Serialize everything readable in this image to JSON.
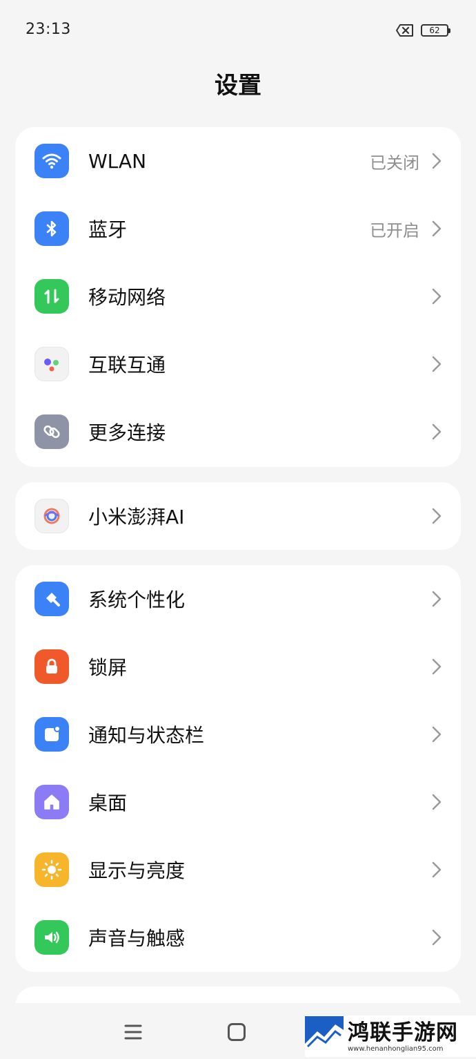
{
  "status_bar": {
    "time": "23:13",
    "battery": "62"
  },
  "title": "设置",
  "groups": [
    {
      "items": [
        {
          "label": "WLAN",
          "value": "已关闭",
          "icon": "wifi-icon",
          "color": "#3b82f6"
        },
        {
          "label": "蓝牙",
          "value": "已开启",
          "icon": "bluetooth-icon",
          "color": "#3b82f6"
        },
        {
          "label": "移动网络",
          "value": "",
          "icon": "mobile-data-icon",
          "color": "#34c759"
        },
        {
          "label": "互联互通",
          "value": "",
          "icon": "interconnect-icon",
          "color": "#f2f2f2"
        },
        {
          "label": "更多连接",
          "value": "",
          "icon": "link-icon",
          "color": "#8e93a6"
        }
      ]
    },
    {
      "items": [
        {
          "label": "小米澎湃AI",
          "value": "",
          "icon": "ai-icon",
          "color": "#f2f2f2"
        }
      ]
    },
    {
      "items": [
        {
          "label": "系统个性化",
          "value": "",
          "icon": "brush-icon",
          "color": "#3b82f6"
        },
        {
          "label": "锁屏",
          "value": "",
          "icon": "lock-icon",
          "color": "#f05a2a"
        },
        {
          "label": "通知与状态栏",
          "value": "",
          "icon": "notification-icon",
          "color": "#3b82f6"
        },
        {
          "label": "桌面",
          "value": "",
          "icon": "home-icon",
          "color": "#8b7cf6"
        },
        {
          "label": "显示与亮度",
          "value": "",
          "icon": "sun-icon",
          "color": "#f7b52c"
        },
        {
          "label": "声音与触感",
          "value": "",
          "icon": "speaker-icon",
          "color": "#34c759"
        }
      ]
    }
  ],
  "watermark": {
    "title": "鸿联手游网",
    "url": "www.henanhonglian95.com"
  }
}
